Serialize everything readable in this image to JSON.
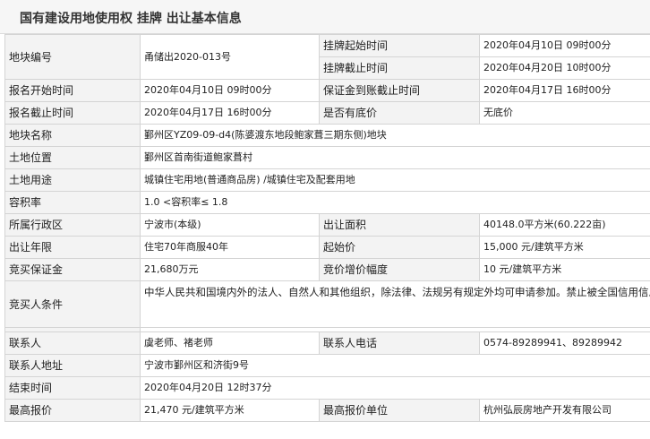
{
  "page": {
    "title": "国有建设用地使用权 挂牌 出让基本信息"
  },
  "rows": {
    "plot_no": {
      "label": "地块编号",
      "value": "甬储出2020-013号"
    },
    "listing_start": {
      "label": "挂牌起始时间",
      "value": "2020年04月10日 09时00分"
    },
    "listing_end": {
      "label": "挂牌截止时间",
      "value": "2020年04月20日 10时00分"
    },
    "signup_start": {
      "label": "报名开始时间",
      "value": "2020年04月10日 09时00分"
    },
    "deposit_deadline": {
      "label": "保证金到账截止时间",
      "value": "2020年04月17日 16时00分"
    },
    "signup_end": {
      "label": "报名截止时间",
      "value": "2020年04月17日 16时00分"
    },
    "reserve_price": {
      "label": "是否有底价",
      "value": "无底价"
    },
    "plot_name": {
      "label": "地块名称",
      "value": "鄞州区YZ09-09-d4(陈婆渡东地段鲍家葺三期东侧)地块"
    },
    "location": {
      "label": "土地位置",
      "value": "鄞州区首南街道鲍家葺村"
    },
    "land_use": {
      "label": "土地用途",
      "value": "城镇住宅用地(普通商品房) /城镇住宅及配套用地"
    },
    "far": {
      "label": "容积率",
      "value": "1.0 <容积率≤ 1.8"
    },
    "district": {
      "label": "所属行政区",
      "value": "宁波市(本级)"
    },
    "area": {
      "label": "出让面积",
      "value": "40148.0平方米(60.222亩)"
    },
    "term": {
      "label": "出让年限",
      "value": "住宅70年商服40年"
    },
    "start_price": {
      "label": "起始价",
      "value": "15,000 元/建筑平方米"
    },
    "bid_deposit": {
      "label": "竞买保证金",
      "value": "21,680万元"
    },
    "increment": {
      "label": "竞价增价幅度",
      "value": "10 元/建筑平方米"
    },
    "conditions": {
      "label": "竞买人条件",
      "value": "中华人民共和国境内外的法人、自然人和其他组织，除法律、法规另有规定外均可申请参加。禁止被全国信用信息共享平台列入“失信黑名单”的单位和个人参加竞买。"
    },
    "contact": {
      "label": "联系人",
      "value": "虞老师、褚老师"
    },
    "phone": {
      "label": "联系人电话",
      "value": "0574-89289941、89289942"
    },
    "address": {
      "label": "联系人地址",
      "value": "宁波市鄞州区和济街9号"
    },
    "end_time": {
      "label": "结束时间",
      "value": "2020年04月20日 12时37分"
    },
    "top_price": {
      "label": "最高报价",
      "value": "21,470 元/建筑平方米"
    },
    "top_bidder": {
      "label": "最高报价单位",
      "value": "杭州弘辰房地产开发有限公司"
    }
  }
}
